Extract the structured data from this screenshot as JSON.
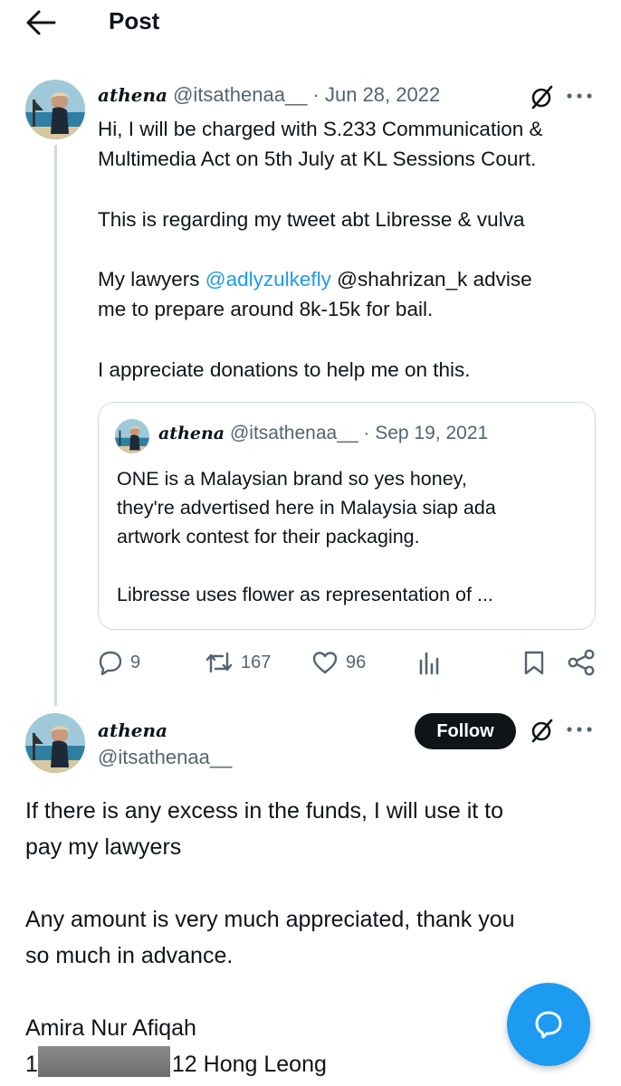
{
  "header": {
    "title": "Post",
    "back_icon": "back-arrow-icon"
  },
  "tweet1": {
    "display_name": "athena",
    "handle": "@itsathenaa__",
    "date": "· Jun 28, 2022",
    "lines": [
      "Hi, I will be charged with S.233 Communication &",
      "Multimedia Act on 5th July at KL Sessions Court."
    ],
    "line2": "This is regarding my tweet abt Libresse & vulva",
    "line3_prefix": "My lawyers ",
    "line3_mention": "@adlyzulkefly",
    "line3_suffix": " @shahrizan_k advise",
    "line4": "me to prepare around 8k-15k for bail.",
    "line5": "I appreciate donations to help me on this.",
    "quote": {
      "display_name": "athena",
      "handle": "@itsathenaa__",
      "date": "· Sep 19, 2021",
      "lines": [
        "ONE is a Malaysian brand so yes honey,",
        "they're advertised here in Malaysia siap ada",
        "artwork contest for their packaging."
      ],
      "last_line": "Libresse uses flower as representation of ..."
    },
    "stats": {
      "replies": "9",
      "reposts": "167",
      "likes": "96"
    }
  },
  "tweet2": {
    "display_name": "athena",
    "handle": "@itsathenaa__",
    "follow_label": "Follow",
    "lines": [
      "If there is any excess in the funds, I will use it to",
      "pay my lawyers"
    ],
    "lines2": [
      "Any amount is very much appreciated, thank you",
      "so much in advance."
    ],
    "account_name": "Amira Nur Afiqah",
    "account_prefix": "1",
    "account_suffix": "12 Hong Leong"
  },
  "colors": {
    "accent": "#1d9bf0",
    "text": "#0f1419",
    "muted": "#536471",
    "border": "#cfd9de"
  }
}
